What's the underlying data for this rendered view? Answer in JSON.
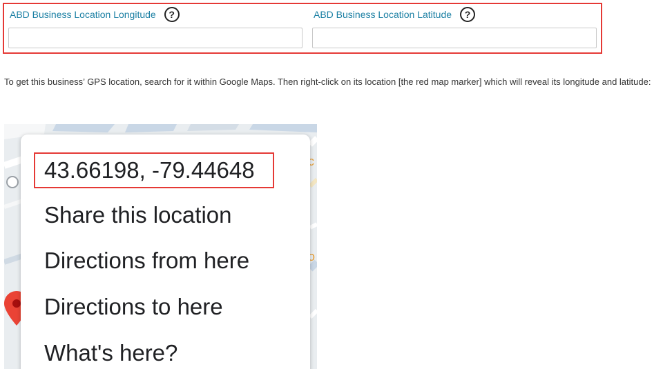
{
  "fields": {
    "longitude": {
      "label": "ABD Business Location Longitude",
      "help": "?",
      "value": ""
    },
    "latitude": {
      "label": "ABD Business Location Latitude",
      "help": "?",
      "value": ""
    }
  },
  "instructions": {
    "text": "To get this business’ GPS location, search for it within Google Maps.  Then right-click on its location [the red map marker] which will reveal its longitude and latitude:"
  },
  "context_menu": {
    "items": [
      "43.66198, -79.44648",
      "Share this location",
      "Directions from here",
      "Directions to here",
      "What's here?"
    ]
  },
  "colors": {
    "highlight": "#e53935",
    "label": "#1a7fa3",
    "marker": "#ea4335"
  }
}
